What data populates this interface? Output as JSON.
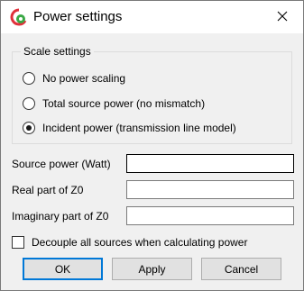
{
  "window": {
    "title": "Power settings"
  },
  "icons": {
    "app": "app-logo-icon",
    "close": "close-icon"
  },
  "scale": {
    "legend": "Scale settings",
    "options": [
      {
        "label": "No power scaling",
        "checked": false
      },
      {
        "label": "Total source power (no mismatch)",
        "checked": false
      },
      {
        "label": "Incident power (transmission line model)",
        "checked": true
      }
    ]
  },
  "fields": {
    "source_power": {
      "label": "Source power (Watt)",
      "value": ""
    },
    "real_z0": {
      "label": "Real part of Z0",
      "value": ""
    },
    "imag_z0": {
      "label": "Imaginary part of Z0",
      "value": ""
    }
  },
  "decouple": {
    "label": "Decouple all sources when calculating power",
    "checked": false
  },
  "buttons": {
    "ok": "OK",
    "apply": "Apply",
    "cancel": "Cancel"
  },
  "colors": {
    "accent": "#0078d7",
    "window_bg": "#f0f0f0",
    "titlebar_bg": "#ffffff"
  }
}
